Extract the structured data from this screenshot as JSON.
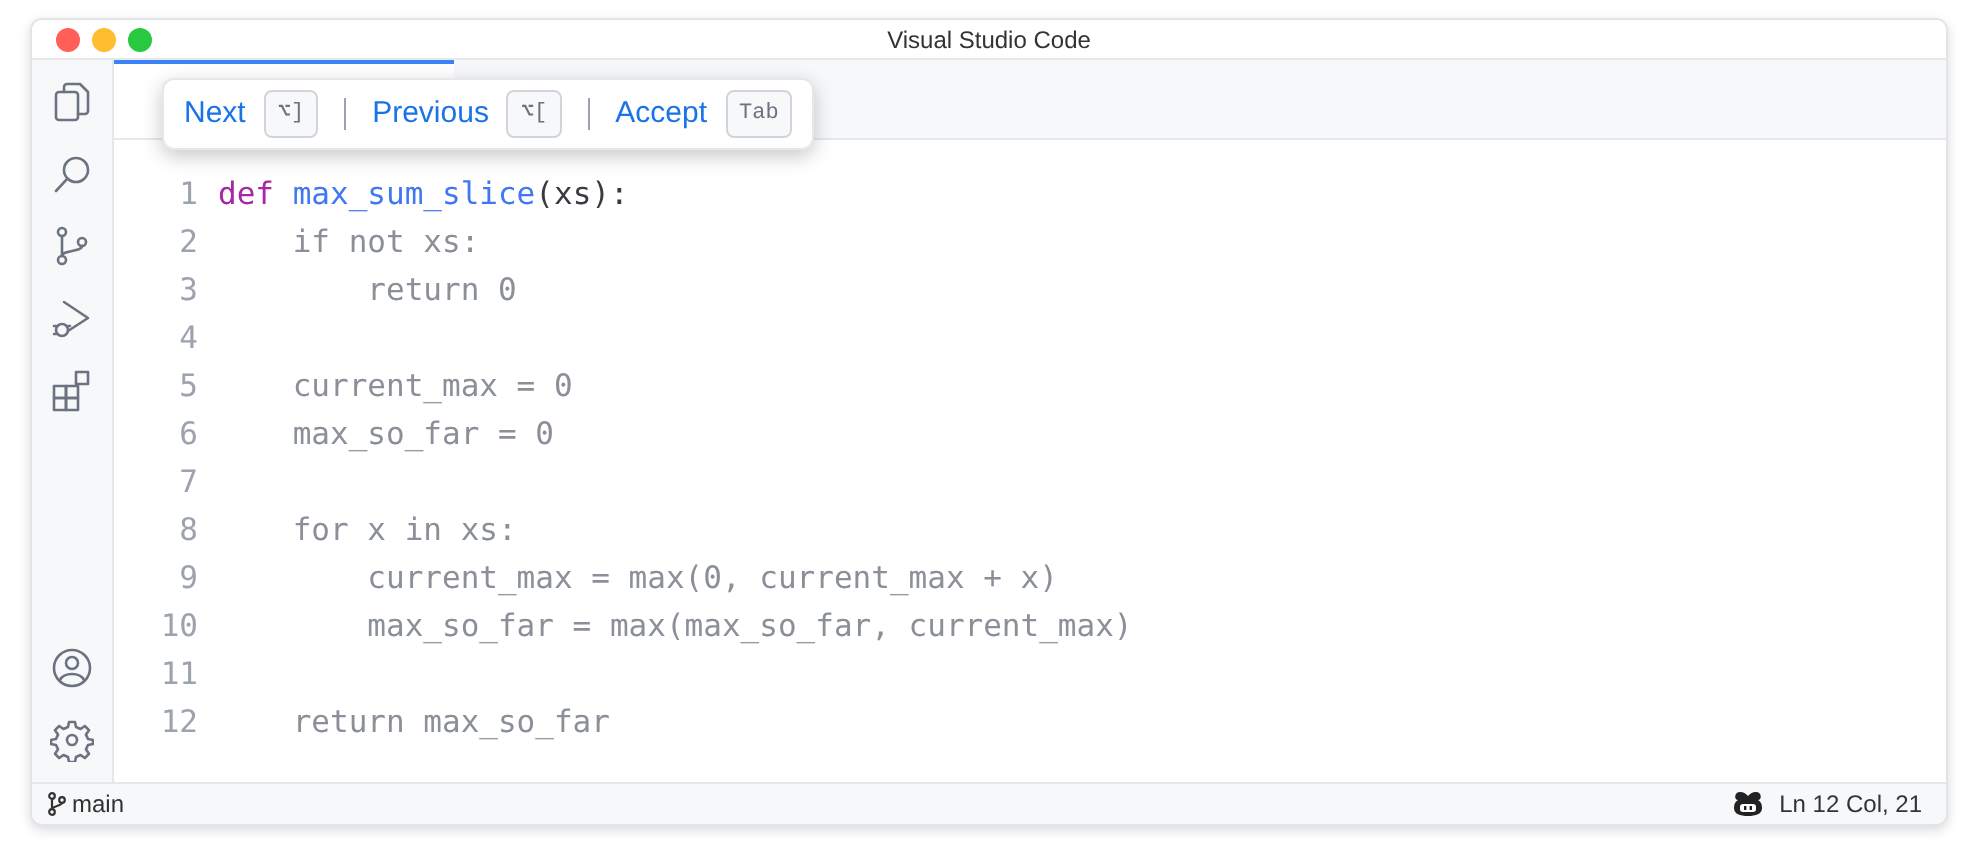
{
  "window": {
    "title": "Visual Studio Code"
  },
  "activity_bar": {
    "top": [
      {
        "kind": "files"
      },
      {
        "kind": "search"
      },
      {
        "kind": "source-control"
      },
      {
        "kind": "run"
      },
      {
        "kind": "extensions"
      }
    ],
    "bottom": [
      {
        "kind": "account"
      },
      {
        "kind": "settings"
      }
    ]
  },
  "suggestion_toolbar": {
    "actions": [
      {
        "label": "Next",
        "key": "⌥]"
      },
      {
        "label": "Previous",
        "key": "⌥["
      },
      {
        "label": "Accept",
        "key": "Tab"
      }
    ]
  },
  "editor": {
    "lines": [
      {
        "number": "1",
        "segments": [
          {
            "text": "def ",
            "kind": "keyword"
          },
          {
            "text": "max_sum_slice",
            "kind": "function"
          },
          {
            "text": "(xs):",
            "kind": "plain"
          }
        ]
      },
      {
        "number": "2",
        "segments": [
          {
            "text": "    if not xs:",
            "kind": "ghost"
          }
        ]
      },
      {
        "number": "3",
        "segments": [
          {
            "text": "        return 0",
            "kind": "ghost"
          }
        ]
      },
      {
        "number": "4"
      },
      {
        "number": "5",
        "segments": [
          {
            "text": "    current_max = 0",
            "kind": "ghost"
          }
        ]
      },
      {
        "number": "6",
        "segments": [
          {
            "text": "    max_so_far = 0",
            "kind": "ghost"
          }
        ]
      },
      {
        "number": "7"
      },
      {
        "number": "8",
        "segments": [
          {
            "text": "    for x in xs:",
            "kind": "ghost"
          }
        ]
      },
      {
        "number": "9",
        "segments": [
          {
            "text": "        current_max = max(0, current_max + x)",
            "kind": "ghost"
          }
        ]
      },
      {
        "number": "10",
        "segments": [
          {
            "text": "        max_so_far = max(max_so_far, current_max)",
            "kind": "ghost"
          }
        ]
      },
      {
        "number": "11"
      },
      {
        "number": "12",
        "segments": [
          {
            "text": "    return max_so_far",
            "kind": "ghost"
          }
        ]
      }
    ]
  },
  "status_bar": {
    "branch": "main",
    "position": "Ln 12 Col, 21"
  }
}
